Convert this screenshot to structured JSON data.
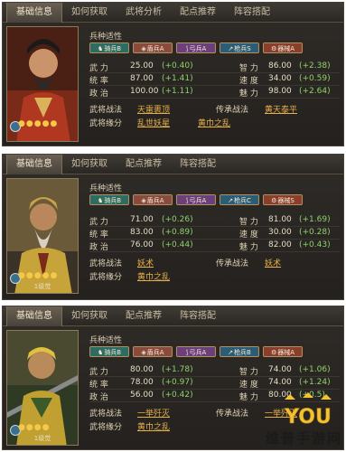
{
  "panels": [
    {
      "tabs": [
        "基础信息",
        "如何获取",
        "武将分析",
        "配点推荐",
        "阵容搭配"
      ],
      "portrait_rank": "",
      "section_title": "兵种适性",
      "troops": [
        "骑兵B",
        "盾兵A",
        "弓兵A",
        "枪兵S",
        "器械A"
      ],
      "stats_left": [
        {
          "name": "武  力",
          "value": "25.00",
          "growth": "(+0.40)"
        },
        {
          "name": "统  率",
          "value": "87.00",
          "growth": "(+1.41)"
        },
        {
          "name": "政  治",
          "value": "100.00",
          "growth": "(+1.11)"
        }
      ],
      "stats_right": [
        {
          "name": "智  力",
          "value": "86.00",
          "growth": "(+2.38)"
        },
        {
          "name": "速  度",
          "value": "34.00",
          "growth": "(+0.59)"
        },
        {
          "name": "魅  力",
          "value": "98.00",
          "growth": "(+2.64)"
        }
      ],
      "skills": [
        {
          "k1": "武将战法",
          "v1": "天雷裹顶",
          "k2": "传承战法",
          "v2": "黄天泰平"
        },
        {
          "k1": "武将缘分",
          "v1": "乱世妖星",
          "k2": "",
          "v2": "黄巾之乱"
        }
      ]
    },
    {
      "tabs": [
        "基础信息",
        "如何获取",
        "配点推荐",
        "阵容搭配"
      ],
      "portrait_rank": "1级觉",
      "section_title": "兵种适性",
      "troops": [
        "骑兵B",
        "盾兵A",
        "弓兵A",
        "枪兵C",
        "器械S"
      ],
      "stats_left": [
        {
          "name": "武  力",
          "value": "71.00",
          "growth": "(+0.26)"
        },
        {
          "name": "统  率",
          "value": "83.00",
          "growth": "(+0.89)"
        },
        {
          "name": "政  治",
          "value": "76.00",
          "growth": "(+0.44)"
        }
      ],
      "stats_right": [
        {
          "name": "智  力",
          "value": "81.00",
          "growth": "(+1.69)"
        },
        {
          "name": "速  度",
          "value": "30.00",
          "growth": "(+0.28)"
        },
        {
          "name": "魅  力",
          "value": "82.00",
          "growth": "(+0.43)"
        }
      ],
      "skills": [
        {
          "k1": "武将战法",
          "v1": "妖术",
          "k2": "传承战法",
          "v2": "妖术"
        },
        {
          "k1": "武将缘分",
          "v1": "黄巾之乱",
          "k2": "",
          "v2": ""
        }
      ]
    },
    {
      "tabs": [
        "基础信息",
        "如何获取",
        "配点推荐",
        "阵容搭配"
      ],
      "portrait_rank": "1级觉",
      "section_title": "兵种适性",
      "troops": [
        "骑兵B",
        "盾兵A",
        "弓兵A",
        "枪兵B",
        "器械A"
      ],
      "stats_left": [
        {
          "name": "武  力",
          "value": "80.00",
          "growth": "(+1.78)"
        },
        {
          "name": "统  率",
          "value": "78.00",
          "growth": "(+0.97)"
        },
        {
          "name": "政  治",
          "value": "56.00",
          "growth": "(+0.42)"
        }
      ],
      "stats_right": [
        {
          "name": "智  力",
          "value": "74.00",
          "growth": "(+1.06)"
        },
        {
          "name": "速  度",
          "value": "74.00",
          "growth": "(+1.24)"
        },
        {
          "name": "魅  力",
          "value": "80.00",
          "growth": "(+0.5)"
        }
      ],
      "skills": [
        {
          "k1": "武将战法",
          "v1": "一举歼灭",
          "k2": "传承战法",
          "v2": "一举歼灭"
        },
        {
          "k1": "武将缘分",
          "v1": "黄巾之乱",
          "k2": "",
          "v2": ""
        }
      ]
    }
  ],
  "watermark": "维普手游网",
  "colors": {
    "growth": "#8fd16c",
    "skill_link": "#e8b04a",
    "star": "#f5c84a"
  }
}
